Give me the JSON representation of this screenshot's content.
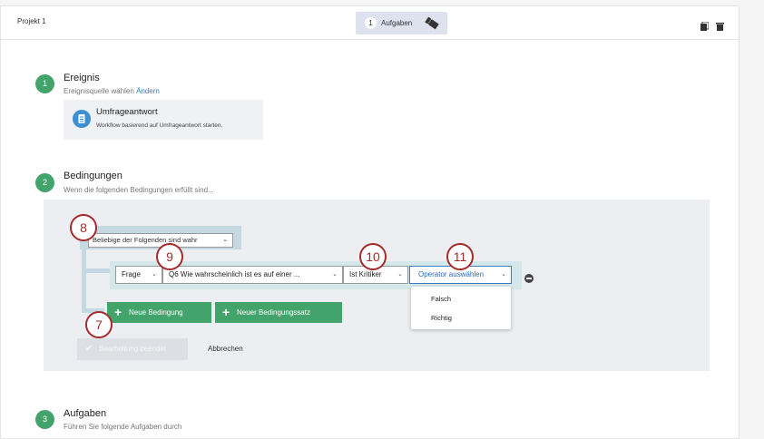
{
  "header": {
    "project_title": "Projekt 1",
    "tasks_count": "1",
    "tasks_label": "Aufgaben",
    "icons": [
      "ticket-icon",
      "copy-icon",
      "trash-icon"
    ]
  },
  "steps": [
    {
      "number": "1",
      "title": "Ereignis",
      "subtitle": "Ereignisquelle wählen",
      "link": "Ändern"
    },
    {
      "number": "2",
      "title": "Bedingungen",
      "subtitle": "Wenn die folgenden Bedingungen erfüllt sind..."
    },
    {
      "number": "3",
      "title": "Aufgaben",
      "subtitle": "Führen Sie folgende Aufgaben durch"
    }
  ],
  "event_source": {
    "title": "Umfrageantwort",
    "description": "Workflow basierend auf Umfrageantwort starten.",
    "icon": "survey-icon"
  },
  "conditions": {
    "group_select": "Beliebige der Folgenden sind wahr",
    "type_select": "Frage",
    "question_select": "Q6 Wie wahrscheinlich ist es auf einer ...",
    "critic_select": "Ist Kritiker",
    "operator_select": "Operator auswählen",
    "operator_options": [
      "Falsch",
      "Richtig"
    ],
    "add_condition_label": "Neue Bedingung",
    "add_condition_set_label": "Neuer Bedingungssatz",
    "done_label": "Bearbeitung beendet",
    "cancel_label": "Abbrechen"
  },
  "callouts": [
    "8",
    "9",
    "10",
    "11",
    "7"
  ],
  "colors": {
    "accent_green": "#43a46b",
    "link_blue": "#3b7dc4",
    "callout_red": "#a52a2a"
  }
}
